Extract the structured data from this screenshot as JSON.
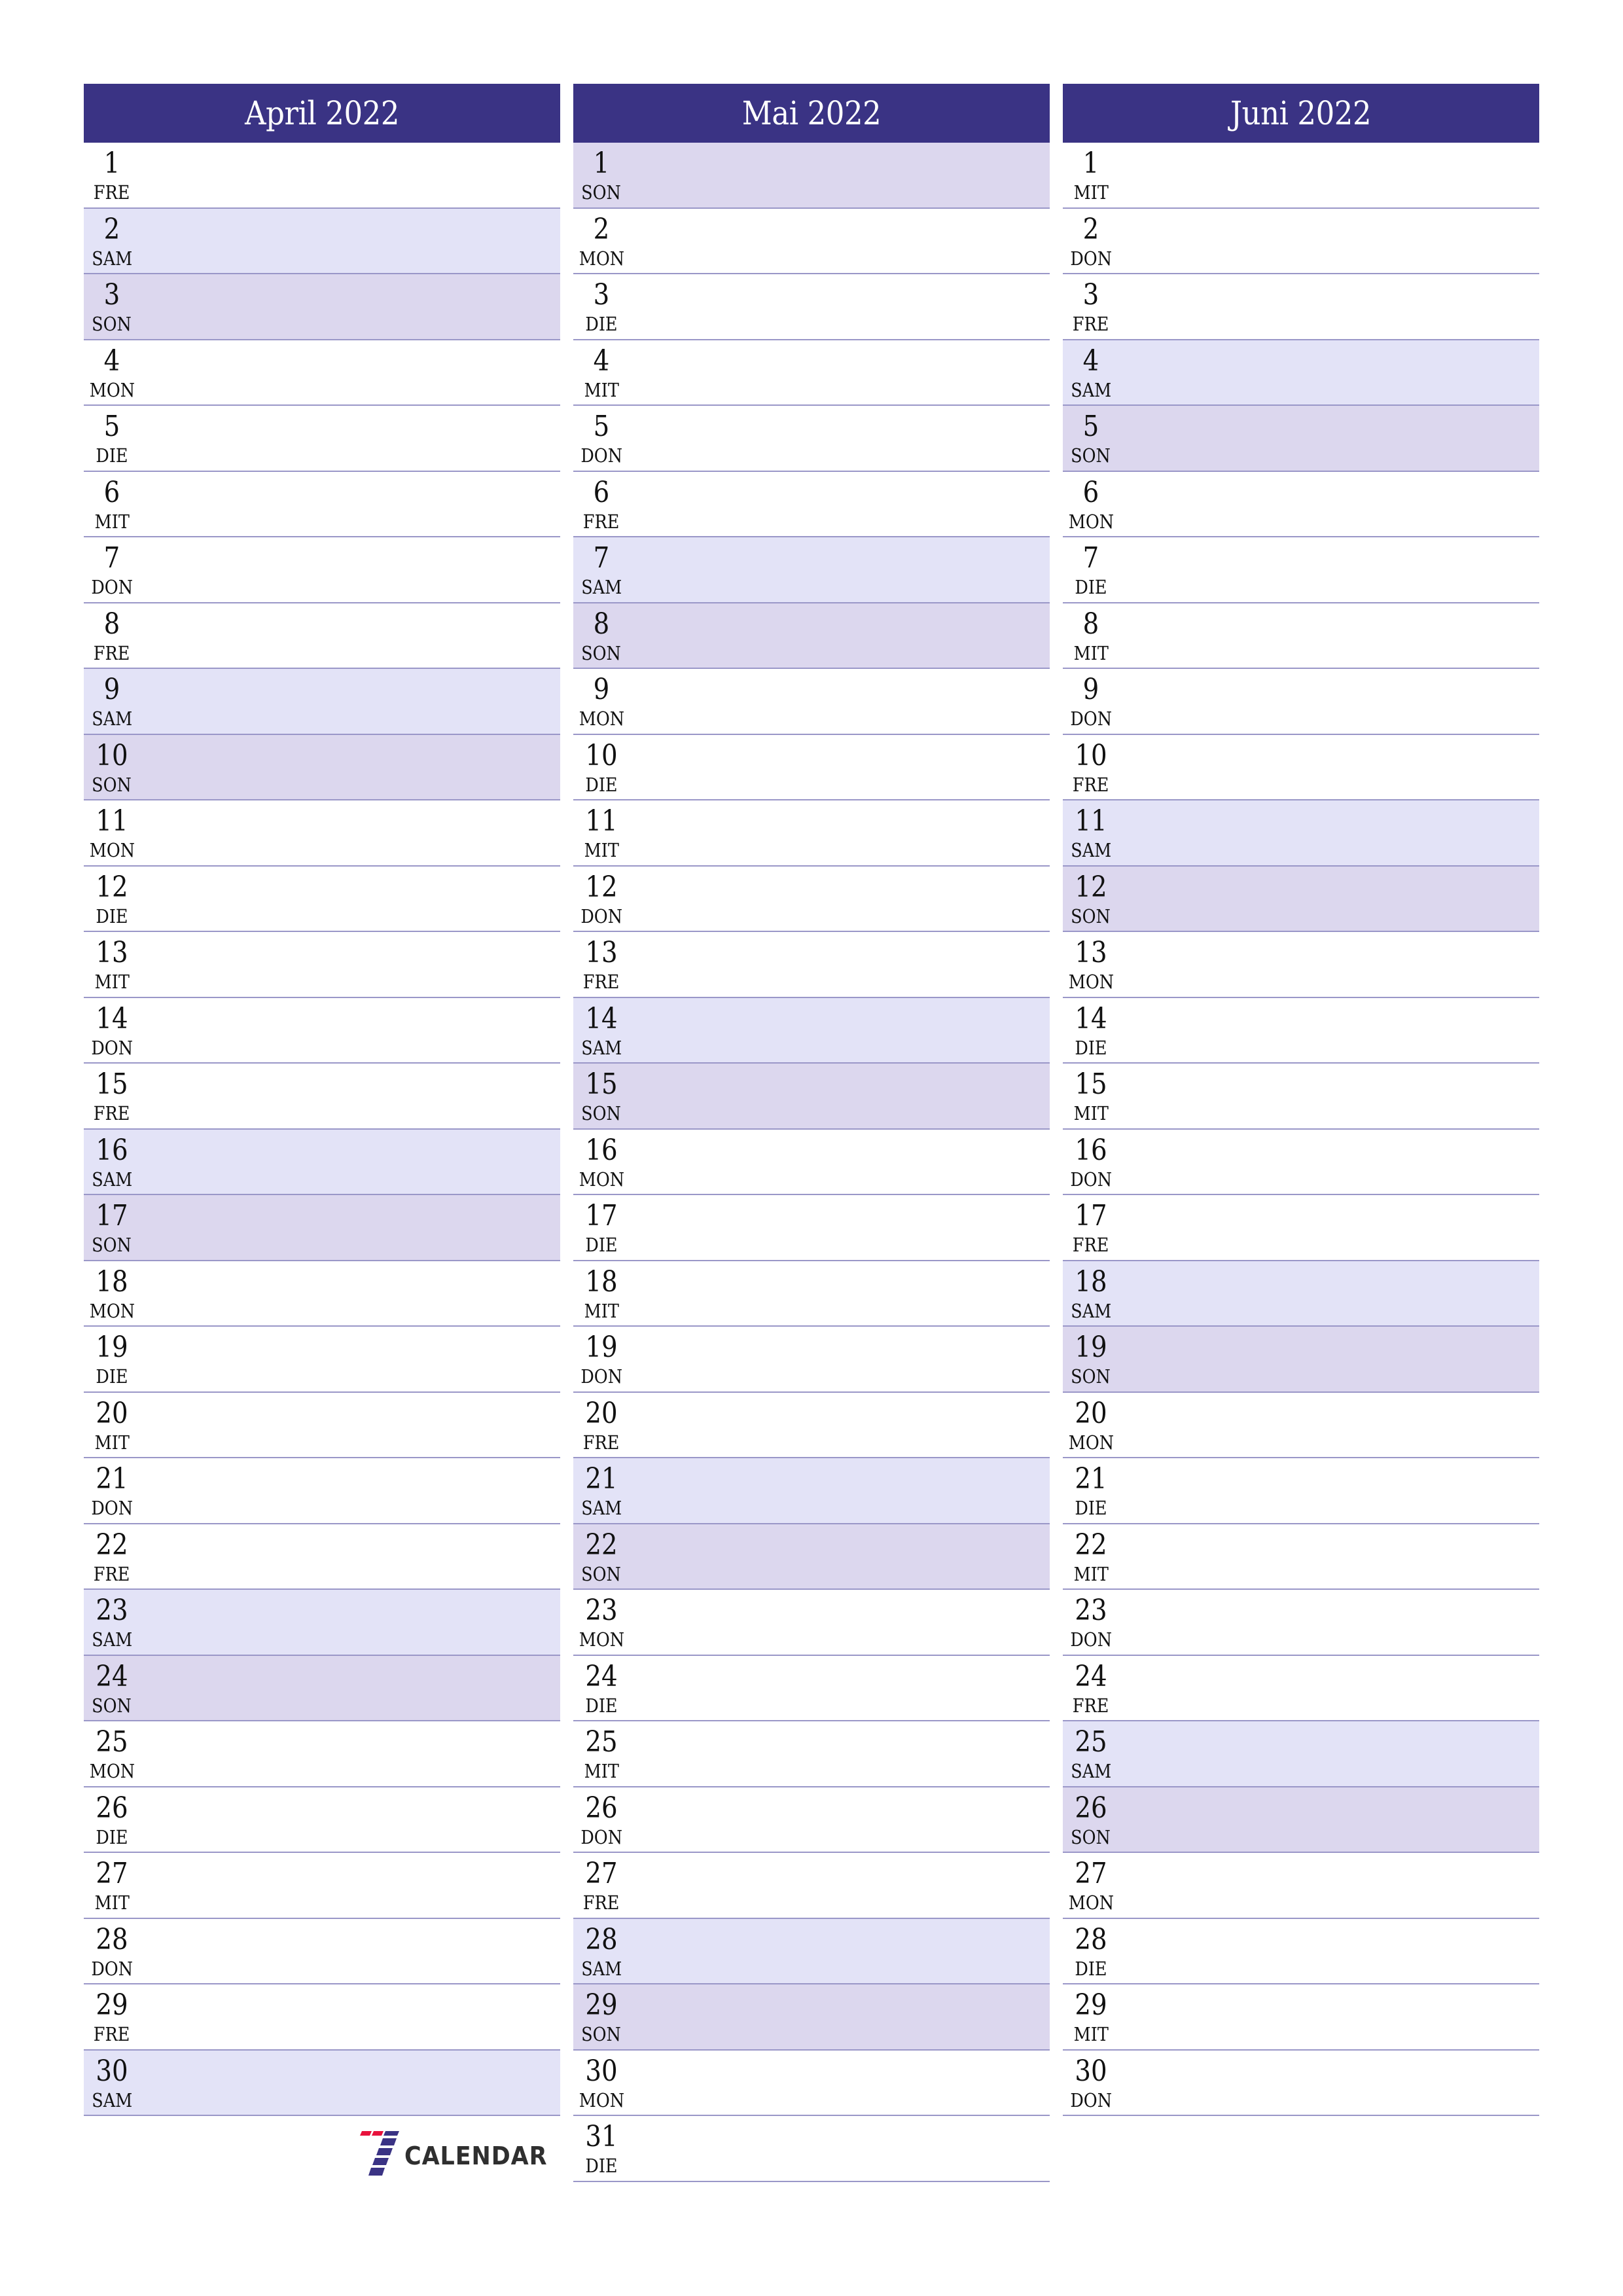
{
  "colors": {
    "header": "#3A3384",
    "saturday": "#E3E3F7",
    "sunday": "#DCD7EE",
    "border": "#9A97C8",
    "logo_red": "#E8123C",
    "logo_navy": "#3A3384"
  },
  "months": [
    {
      "title": "April 2022",
      "days": [
        {
          "n": "1",
          "d": "FRE"
        },
        {
          "n": "2",
          "d": "SAM"
        },
        {
          "n": "3",
          "d": "SON"
        },
        {
          "n": "4",
          "d": "MON"
        },
        {
          "n": "5",
          "d": "DIE"
        },
        {
          "n": "6",
          "d": "MIT"
        },
        {
          "n": "7",
          "d": "DON"
        },
        {
          "n": "8",
          "d": "FRE"
        },
        {
          "n": "9",
          "d": "SAM"
        },
        {
          "n": "10",
          "d": "SON"
        },
        {
          "n": "11",
          "d": "MON"
        },
        {
          "n": "12",
          "d": "DIE"
        },
        {
          "n": "13",
          "d": "MIT"
        },
        {
          "n": "14",
          "d": "DON"
        },
        {
          "n": "15",
          "d": "FRE"
        },
        {
          "n": "16",
          "d": "SAM"
        },
        {
          "n": "17",
          "d": "SON"
        },
        {
          "n": "18",
          "d": "MON"
        },
        {
          "n": "19",
          "d": "DIE"
        },
        {
          "n": "20",
          "d": "MIT"
        },
        {
          "n": "21",
          "d": "DON"
        },
        {
          "n": "22",
          "d": "FRE"
        },
        {
          "n": "23",
          "d": "SAM"
        },
        {
          "n": "24",
          "d": "SON"
        },
        {
          "n": "25",
          "d": "MON"
        },
        {
          "n": "26",
          "d": "DIE"
        },
        {
          "n": "27",
          "d": "MIT"
        },
        {
          "n": "28",
          "d": "DON"
        },
        {
          "n": "29",
          "d": "FRE"
        },
        {
          "n": "30",
          "d": "SAM"
        }
      ]
    },
    {
      "title": "Mai 2022",
      "days": [
        {
          "n": "1",
          "d": "SON"
        },
        {
          "n": "2",
          "d": "MON"
        },
        {
          "n": "3",
          "d": "DIE"
        },
        {
          "n": "4",
          "d": "MIT"
        },
        {
          "n": "5",
          "d": "DON"
        },
        {
          "n": "6",
          "d": "FRE"
        },
        {
          "n": "7",
          "d": "SAM"
        },
        {
          "n": "8",
          "d": "SON"
        },
        {
          "n": "9",
          "d": "MON"
        },
        {
          "n": "10",
          "d": "DIE"
        },
        {
          "n": "11",
          "d": "MIT"
        },
        {
          "n": "12",
          "d": "DON"
        },
        {
          "n": "13",
          "d": "FRE"
        },
        {
          "n": "14",
          "d": "SAM"
        },
        {
          "n": "15",
          "d": "SON"
        },
        {
          "n": "16",
          "d": "MON"
        },
        {
          "n": "17",
          "d": "DIE"
        },
        {
          "n": "18",
          "d": "MIT"
        },
        {
          "n": "19",
          "d": "DON"
        },
        {
          "n": "20",
          "d": "FRE"
        },
        {
          "n": "21",
          "d": "SAM"
        },
        {
          "n": "22",
          "d": "SON"
        },
        {
          "n": "23",
          "d": "MON"
        },
        {
          "n": "24",
          "d": "DIE"
        },
        {
          "n": "25",
          "d": "MIT"
        },
        {
          "n": "26",
          "d": "DON"
        },
        {
          "n": "27",
          "d": "FRE"
        },
        {
          "n": "28",
          "d": "SAM"
        },
        {
          "n": "29",
          "d": "SON"
        },
        {
          "n": "30",
          "d": "MON"
        },
        {
          "n": "31",
          "d": "DIE"
        }
      ]
    },
    {
      "title": "Juni 2022",
      "days": [
        {
          "n": "1",
          "d": "MIT"
        },
        {
          "n": "2",
          "d": "DON"
        },
        {
          "n": "3",
          "d": "FRE"
        },
        {
          "n": "4",
          "d": "SAM"
        },
        {
          "n": "5",
          "d": "SON"
        },
        {
          "n": "6",
          "d": "MON"
        },
        {
          "n": "7",
          "d": "DIE"
        },
        {
          "n": "8",
          "d": "MIT"
        },
        {
          "n": "9",
          "d": "DON"
        },
        {
          "n": "10",
          "d": "FRE"
        },
        {
          "n": "11",
          "d": "SAM"
        },
        {
          "n": "12",
          "d": "SON"
        },
        {
          "n": "13",
          "d": "MON"
        },
        {
          "n": "14",
          "d": "DIE"
        },
        {
          "n": "15",
          "d": "MIT"
        },
        {
          "n": "16",
          "d": "DON"
        },
        {
          "n": "17",
          "d": "FRE"
        },
        {
          "n": "18",
          "d": "SAM"
        },
        {
          "n": "19",
          "d": "SON"
        },
        {
          "n": "20",
          "d": "MON"
        },
        {
          "n": "21",
          "d": "DIE"
        },
        {
          "n": "22",
          "d": "MIT"
        },
        {
          "n": "23",
          "d": "DON"
        },
        {
          "n": "24",
          "d": "FRE"
        },
        {
          "n": "25",
          "d": "SAM"
        },
        {
          "n": "26",
          "d": "SON"
        },
        {
          "n": "27",
          "d": "MON"
        },
        {
          "n": "28",
          "d": "DIE"
        },
        {
          "n": "29",
          "d": "MIT"
        },
        {
          "n": "30",
          "d": "DON"
        }
      ]
    }
  ],
  "logo": {
    "icon": "seven-logo-icon",
    "text": "CALENDAR"
  }
}
